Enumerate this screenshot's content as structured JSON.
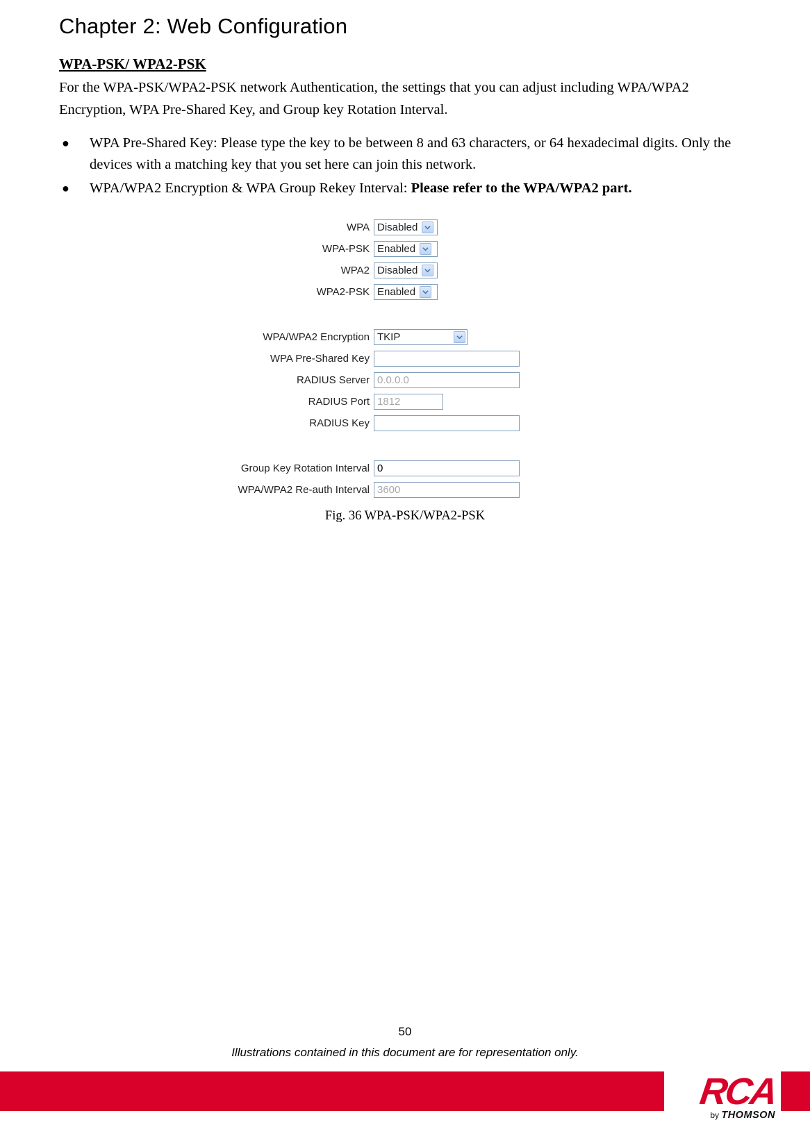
{
  "chapter_title": "Chapter 2: Web Configuration",
  "section_title": "WPA-PSK/ WPA2-PSK",
  "intro": "For the WPA-PSK/WPA2-PSK network Authentication, the settings that you can adjust including WPA/WPA2 Encryption, WPA Pre-Shared Key, and Group key Rotation Interval.",
  "bullets": {
    "b1": "WPA Pre-Shared Key: Please type the key to be between 8 and 63 characters, or 64 hexadecimal digits. Only the devices with a matching key that you set here can join this network.",
    "b2_prefix": "WPA/WPA2 Encryption & WPA Group Rekey Interval: ",
    "b2_bold": "Please refer to the WPA/WPA2 part."
  },
  "figure": {
    "labels": {
      "wpa": "WPA",
      "wpa_psk": "WPA-PSK",
      "wpa2": "WPA2",
      "wpa2_psk": "WPA2-PSK",
      "encryption": "WPA/WPA2 Encryption",
      "preshared": "WPA Pre-Shared Key",
      "rserver": "RADIUS Server",
      "rport": "RADIUS Port",
      "rkey": "RADIUS Key",
      "gkri": "Group Key Rotation Interval",
      "reauth": "WPA/WPA2 Re-auth Interval"
    },
    "values": {
      "wpa": "Disabled",
      "wpa_psk": "Enabled",
      "wpa2": "Disabled",
      "wpa2_psk": "Enabled",
      "encryption": "TKIP",
      "preshared": "",
      "rserver": "0.0.0.0",
      "rport": "1812",
      "rkey": "",
      "gkri": "0",
      "reauth": "3600"
    },
    "caption": "Fig. 36 WPA-PSK/WPA2-PSK"
  },
  "footer": {
    "page_number": "50",
    "disclaimer": "Illustrations contained in this document are for representation only.",
    "logo_main": "RCA",
    "logo_by": "by ",
    "logo_brand": "THOMSON"
  }
}
